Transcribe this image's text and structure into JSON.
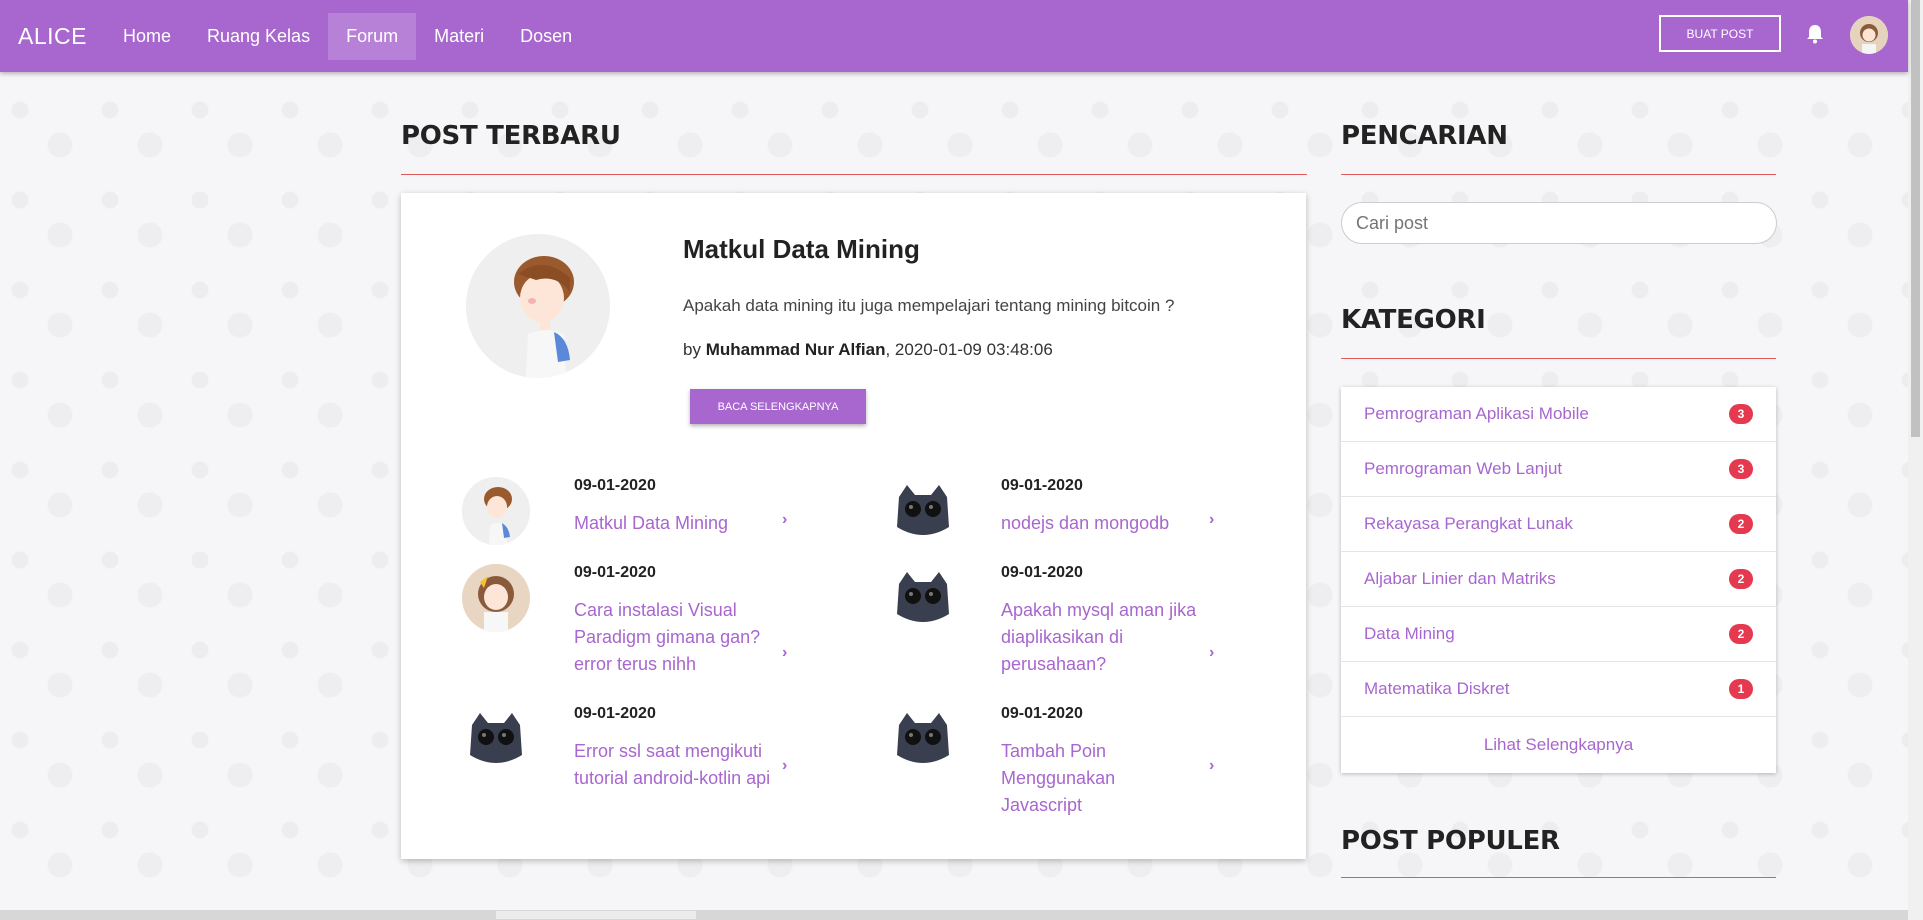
{
  "navbar": {
    "brand": "ALICE",
    "links": [
      {
        "label": "Home",
        "active": false
      },
      {
        "label": "Ruang Kelas",
        "active": false
      },
      {
        "label": "Forum",
        "active": true
      },
      {
        "label": "Materi",
        "active": false
      },
      {
        "label": "Dosen",
        "active": false
      }
    ],
    "create_post_label": "BUAT POST",
    "accent_color": "#a866cf"
  },
  "latest": {
    "heading": "POST TERBARU",
    "featured": {
      "title": "Matkul Data Mining",
      "description": "Apakah data mining itu juga mempelajari tentang mining bitcoin ?",
      "by_prefix": "by ",
      "author": "Muhammad Nur Alfian",
      "datetime": ", 2020-01-09 03:48:06",
      "read_more_label": "BACA SELENGKAPNYA"
    },
    "posts": [
      {
        "date": "09-01-2020",
        "title": "Matkul Data Mining",
        "thumb": "boy-avatar"
      },
      {
        "date": "09-01-2020",
        "title": "nodejs dan mongodb",
        "thumb": "cat-glasses-avatar"
      },
      {
        "date": "09-01-2020",
        "title": "Cara instalasi Visual Paradigm gimana gan? error terus nihh",
        "thumb": "girl-avatar"
      },
      {
        "date": "09-01-2020",
        "title": "Apakah mysql aman jika diaplikasikan di perusahaan?",
        "thumb": "cat-glasses-avatar"
      },
      {
        "date": "09-01-2020",
        "title": "Error ssl saat mengikuti tutorial android-kotlin api",
        "thumb": "cat-glasses-avatar"
      },
      {
        "date": "09-01-2020",
        "title": "Tambah Poin Menggunakan Javascript",
        "thumb": "cat-glasses-avatar"
      }
    ]
  },
  "sidebar": {
    "search_heading": "PENCARIAN",
    "search_placeholder": "Cari post",
    "category_heading": "KATEGORI",
    "categories": [
      {
        "name": "Pemrograman Aplikasi Mobile",
        "count": "3"
      },
      {
        "name": "Pemrograman Web Lanjut",
        "count": "3"
      },
      {
        "name": "Rekayasa Perangkat Lunak",
        "count": "2"
      },
      {
        "name": "Aljabar Linier dan Matriks",
        "count": "2"
      },
      {
        "name": "Data Mining",
        "count": "2"
      },
      {
        "name": "Matematika Diskret",
        "count": "1"
      }
    ],
    "more_label": "Lihat Selengkapnya",
    "popular_heading": "POST POPULER"
  }
}
